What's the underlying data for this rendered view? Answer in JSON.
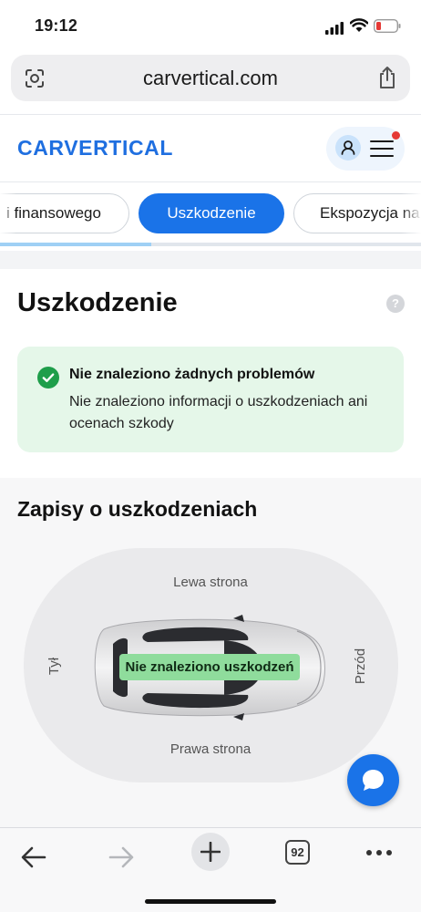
{
  "status_bar": {
    "time": "19:12"
  },
  "browser": {
    "url": "carvertical.com",
    "open_tabs_count": "92"
  },
  "site": {
    "logo": "CARVERTICAL",
    "brand_color": "#1f6fe0"
  },
  "tabs": [
    {
      "label": "i finansowego",
      "active": false
    },
    {
      "label": "Uszkodzenie",
      "active": true
    },
    {
      "label": "Ekspozycja na",
      "active": false
    }
  ],
  "tab_scroll_progress_percent": 36,
  "damage_section": {
    "title": "Uszkodzenie",
    "help_symbol": "?",
    "status": {
      "title": "Nie znaleziono żadnych problemów",
      "description": "Nie znaleziono informacji o uszkodzeniach ani ocenach szkody",
      "color": "#e5f7e9"
    }
  },
  "records_section": {
    "title": "Zapisy o uszkodzeniach",
    "side_labels": {
      "left": "Lewa strona",
      "right": "Prawa strona",
      "rear": "Tył",
      "front": "Przód"
    },
    "badge": "Nie znaleziono uszkodzeń"
  },
  "icons": {
    "lens": "lens-icon",
    "share": "share-icon",
    "avatar": "user-icon",
    "menu": "hamburger-menu-icon",
    "help": "help-icon",
    "check": "check-circle-icon",
    "chat": "chat-bubble-icon",
    "back": "arrow-left-icon",
    "forward": "arrow-right-icon",
    "new_tab": "plus-icon",
    "more": "more-dots-icon"
  }
}
